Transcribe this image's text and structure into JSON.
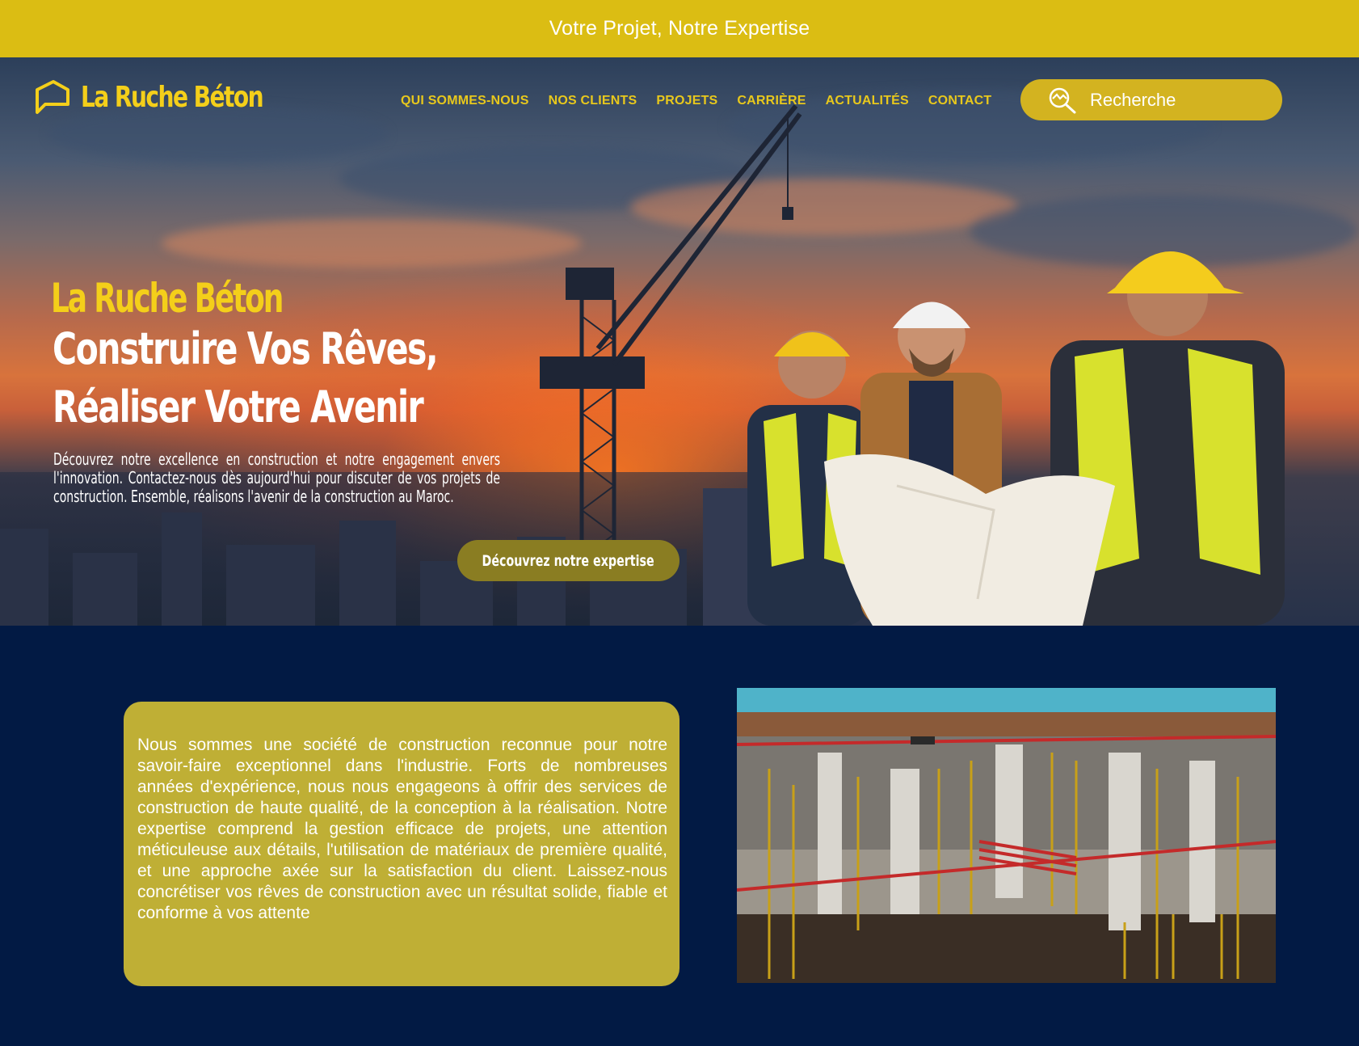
{
  "topbar": {
    "tagline": "Votre Projet, Notre Expertise"
  },
  "header": {
    "logo_text": "La Ruche Béton",
    "nav": [
      "QUI SOMMES-NOUS",
      "NOS CLIENTS",
      "PROJETS",
      "CARRIÈRE",
      "ACTUALITÉS",
      "CONTACT"
    ],
    "search": {
      "placeholder": "Recherche",
      "icon": "search-icon"
    }
  },
  "hero": {
    "brand": "La Ruche Béton",
    "title": "Construire Vos Rêves, Réaliser Votre Avenir",
    "description": "Découvrez notre excellence en construction et notre engagement envers l'innovation. Contactez-nous dès aujourd'hui pour discuter de vos projets de construction. Ensemble, réalisons l'avenir de la construction au Maroc.",
    "cta_label": "Découvrez notre expertise"
  },
  "about": {
    "text": "Nous sommes une société de construction reconnue pour notre savoir-faire exceptionnel dans l'industrie. Forts de nombreuses années d'expérience, nous nous engageons à offrir des services de construction de haute qualité, de la conception à la réalisation. Notre expertise comprend la gestion efficace de projets, une attention méticuleuse aux détails, l'utilisation de matériaux de première qualité, et une approche axée sur la satisfaction du client. Laissez-nous concrétiser vos rêves de construction avec un résultat solide, fiable et conforme à vos attente"
  },
  "colors": {
    "topbar": "#dbbd13",
    "accent": "#f4cf1a",
    "navy": "#021a44",
    "card": "#bfaf35",
    "cta": "#8a7d22"
  }
}
